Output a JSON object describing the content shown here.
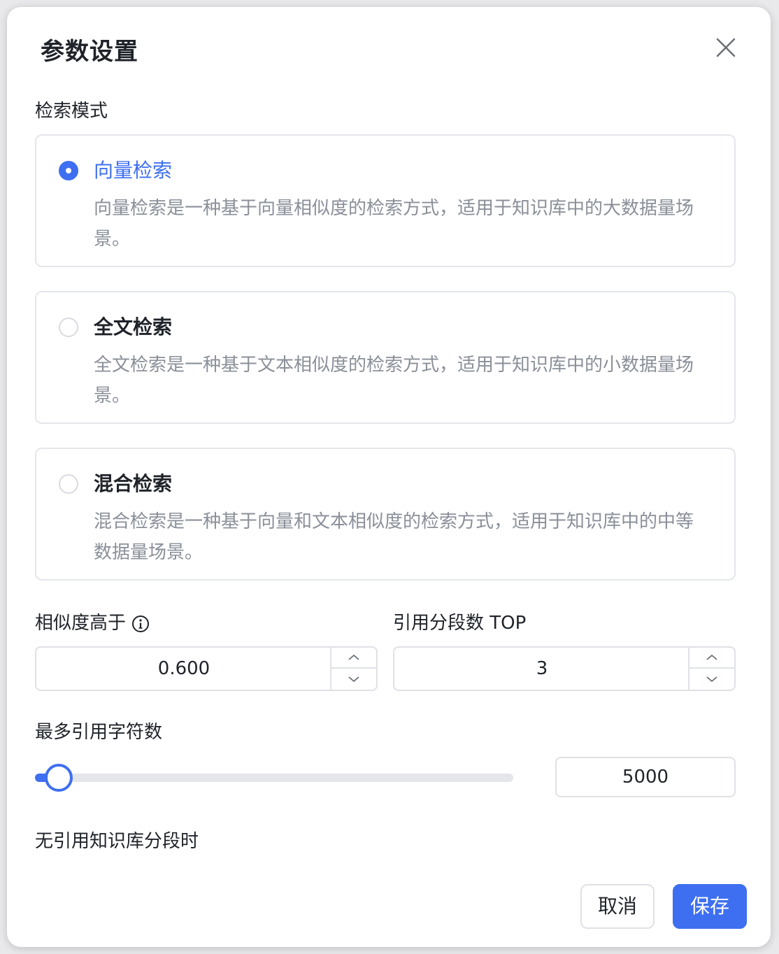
{
  "dialog": {
    "title": "参数设置",
    "close_icon": "close-icon"
  },
  "search_mode": {
    "label": "检索模式",
    "options": [
      {
        "name": "向量检索",
        "description": "向量检索是一种基于向量相似度的检索方式，适用于知识库中的大数据量场景。",
        "selected": true
      },
      {
        "name": "全文检索",
        "description": "全文检索是一种基于文本相似度的检索方式，适用于知识库中的小数据量场景。",
        "selected": false
      },
      {
        "name": "混合检索",
        "description": "混合检索是一种基于向量和文本相似度的检索方式，适用于知识库中的中等数据量场景。",
        "selected": false
      }
    ]
  },
  "similarity": {
    "label": "相似度高于",
    "info_icon": "info-icon",
    "value": "0.600"
  },
  "top_segments": {
    "label": "引用分段数 TOP",
    "value": "3"
  },
  "max_chars": {
    "label": "最多引用字符数",
    "value": "5000",
    "slider_fraction": 0.05
  },
  "no_reference": {
    "label": "无引用知识库分段时"
  },
  "footer": {
    "cancel_label": "取消",
    "save_label": "保存"
  },
  "colors": {
    "accent": "#3e6ff0",
    "border": "#e4e6eb",
    "muted_text": "#8a8f99"
  }
}
